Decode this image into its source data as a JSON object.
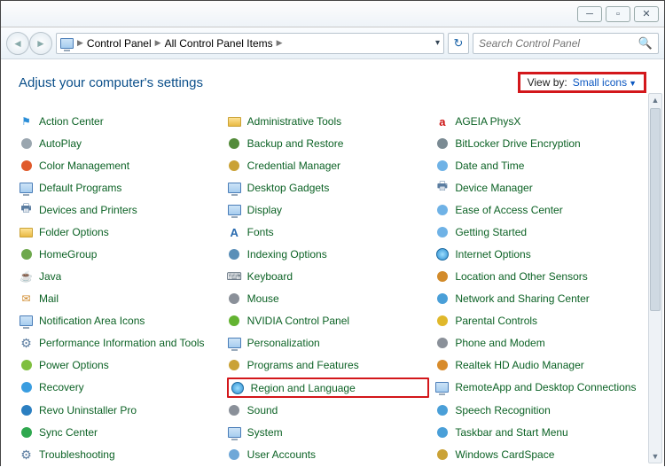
{
  "breadcrumb": {
    "item1": "Control Panel",
    "item2": "All Control Panel Items"
  },
  "search": {
    "placeholder": "Search Control Panel"
  },
  "heading": "Adjust your computer's settings",
  "viewby": {
    "label": "View by:",
    "value": "Small icons"
  },
  "items": {
    "c0": [
      "Action Center",
      "AutoPlay",
      "Color Management",
      "Default Programs",
      "Devices and Printers",
      "Folder Options",
      "HomeGroup",
      "Java",
      "Mail",
      "Notification Area Icons",
      "Performance Information and Tools",
      "Power Options",
      "Recovery",
      "Revo Uninstaller Pro",
      "Sync Center",
      "Troubleshooting"
    ],
    "c1": [
      "Administrative Tools",
      "Backup and Restore",
      "Credential Manager",
      "Desktop Gadgets",
      "Display",
      "Fonts",
      "Indexing Options",
      "Keyboard",
      "Mouse",
      "NVIDIA Control Panel",
      "Personalization",
      "Programs and Features",
      "Region and Language",
      "Sound",
      "System",
      "User Accounts"
    ],
    "c2": [
      "AGEIA PhysX",
      "BitLocker Drive Encryption",
      "Date and Time",
      "Device Manager",
      "Ease of Access Center",
      "Getting Started",
      "Internet Options",
      "Location and Other Sensors",
      "Network and Sharing Center",
      "Parental Controls",
      "Phone and Modem",
      "Realtek HD Audio Manager",
      "RemoteApp and Desktop Connections",
      "Speech Recognition",
      "Taskbar and Start Menu",
      "Windows CardSpace"
    ]
  },
  "highlighted": "Region and Language",
  "icons": {
    "Action Center": {
      "t": "flag",
      "c": "#2b8ed8"
    },
    "AutoPlay": {
      "t": "dot",
      "c": "#9aa6af"
    },
    "Color Management": {
      "t": "dot",
      "c": "#e05a2b"
    },
    "Default Programs": {
      "t": "monitor"
    },
    "Devices and Printers": {
      "t": "printer"
    },
    "Folder Options": {
      "t": "folder"
    },
    "HomeGroup": {
      "t": "dot",
      "c": "#6da84c"
    },
    "Java": {
      "t": "java"
    },
    "Mail": {
      "t": "mail"
    },
    "Notification Area Icons": {
      "t": "monitor"
    },
    "Performance Information and Tools": {
      "t": "gear"
    },
    "Power Options": {
      "t": "dot",
      "c": "#7fbf3f"
    },
    "Recovery": {
      "t": "dot",
      "c": "#3a9de0"
    },
    "Revo Uninstaller Pro": {
      "t": "dot",
      "c": "#2b7fc1"
    },
    "Sync Center": {
      "t": "dot",
      "c": "#2fa84f"
    },
    "Troubleshooting": {
      "t": "gear"
    },
    "Administrative Tools": {
      "t": "folder"
    },
    "Backup and Restore": {
      "t": "dot",
      "c": "#538b3a"
    },
    "Credential Manager": {
      "t": "dot",
      "c": "#caa236"
    },
    "Desktop Gadgets": {
      "t": "monitor"
    },
    "Display": {
      "t": "monitor"
    },
    "Fonts": {
      "t": "fonts"
    },
    "Indexing Options": {
      "t": "dot",
      "c": "#5a8fb8"
    },
    "Keyboard": {
      "t": "kbrd"
    },
    "Mouse": {
      "t": "dot",
      "c": "#8a9099"
    },
    "NVIDIA Control Panel": {
      "t": "dot",
      "c": "#63b331"
    },
    "Personalization": {
      "t": "monitor"
    },
    "Programs and Features": {
      "t": "dot",
      "c": "#caa236"
    },
    "Region and Language": {
      "t": "globe"
    },
    "Sound": {
      "t": "dot",
      "c": "#8a9099"
    },
    "System": {
      "t": "monitor"
    },
    "User Accounts": {
      "t": "dot",
      "c": "#6fa8d8"
    },
    "AGEIA PhysX": {
      "t": "ageia"
    },
    "BitLocker Drive Encryption": {
      "t": "dot",
      "c": "#7a8a93"
    },
    "Date and Time": {
      "t": "dot",
      "c": "#6fb2e6"
    },
    "Device Manager": {
      "t": "printer"
    },
    "Ease of Access Center": {
      "t": "dot",
      "c": "#6fb2e6"
    },
    "Getting Started": {
      "t": "dot",
      "c": "#6fb2e6"
    },
    "Internet Options": {
      "t": "globe"
    },
    "Location and Other Sensors": {
      "t": "dot",
      "c": "#d28b2b"
    },
    "Network and Sharing Center": {
      "t": "dot",
      "c": "#4a9fd8"
    },
    "Parental Controls": {
      "t": "dot",
      "c": "#e0b82b"
    },
    "Phone and Modem": {
      "t": "dot",
      "c": "#8a9099"
    },
    "Realtek HD Audio Manager": {
      "t": "dot",
      "c": "#d88b2b"
    },
    "RemoteApp and Desktop Connections": {
      "t": "monitor"
    },
    "Speech Recognition": {
      "t": "dot",
      "c": "#4a9fd8"
    },
    "Taskbar and Start Menu": {
      "t": "dot",
      "c": "#4a9fd8"
    },
    "Windows CardSpace": {
      "t": "dot",
      "c": "#caa236"
    }
  }
}
